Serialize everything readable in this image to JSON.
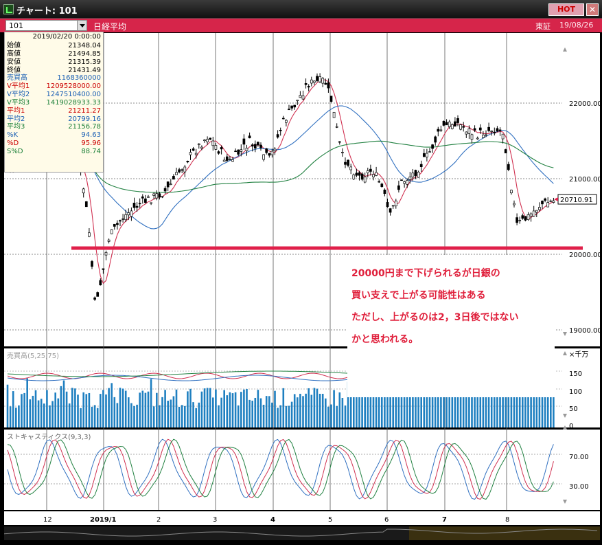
{
  "window": {
    "title": "チャート: 101",
    "hot_label": "HOT",
    "close_label": "✕"
  },
  "symbol_bar": {
    "code": "101",
    "name": "日経平均",
    "exchange": "東証",
    "date": "19/08/26"
  },
  "ohlc_panel": {
    "datetime": "2019/02/20 0:00:00",
    "rows": [
      {
        "label": "始値",
        "value": "21348.04",
        "color": "#000000"
      },
      {
        "label": "高値",
        "value": "21494.85",
        "color": "#000000"
      },
      {
        "label": "安値",
        "value": "21315.39",
        "color": "#000000"
      },
      {
        "label": "終値",
        "value": "21431.49",
        "color": "#000000"
      },
      {
        "label": "売買高",
        "value": "1168360000",
        "color": "#1a5fb4"
      },
      {
        "label": "V平均1",
        "value": "1209528000.00",
        "color": "#cc0000"
      },
      {
        "label": "V平均2",
        "value": "1247510400.00",
        "color": "#1a5fb4"
      },
      {
        "label": "V平均3",
        "value": "1419028933.33",
        "color": "#1a7f37"
      },
      {
        "label": "平均1",
        "value": "21211.27",
        "color": "#cc0000"
      },
      {
        "label": "平均2",
        "value": "20799.16",
        "color": "#1a5fb4"
      },
      {
        "label": "平均3",
        "value": "21156.78",
        "color": "#1a7f37"
      },
      {
        "label": "%K",
        "value": "94.63",
        "color": "#1a5fb4"
      },
      {
        "label": "%D",
        "value": "95.96",
        "color": "#cc0000"
      },
      {
        "label": "S%D",
        "value": "88.74",
        "color": "#1a7f37"
      }
    ]
  },
  "chart": {
    "price_ticks": [
      "22000.00",
      "21000.00",
      "20000.00",
      "19000.00"
    ],
    "last_price": "20710.91",
    "volume_title": "売買高(5,25,75)",
    "volume_unit": "×千万",
    "volume_ticks": [
      "150",
      "100",
      "50",
      "0"
    ],
    "stoch_title": "ストキャスティクス(9,3,3)",
    "stoch_ticks": [
      "70.00",
      "30.00"
    ],
    "date_ticks": [
      "12",
      "2019/1",
      "2",
      "3",
      "4",
      "5",
      "6",
      "7",
      "8"
    ]
  },
  "annotation": {
    "lines": [
      "20000円まで下げられるが日銀の",
      "買い支えで上がる可能性はある",
      "ただし、上がるのは2，3日後ではない",
      "かと思われる。"
    ]
  },
  "colors": {
    "candle_up": "#ffffff",
    "candle_down": "#000000",
    "ma1": "#d03050",
    "ma2": "#3070c0",
    "ma3": "#208040",
    "support_line": "#e0204a",
    "volume_bar": "#1e7fc0"
  }
}
